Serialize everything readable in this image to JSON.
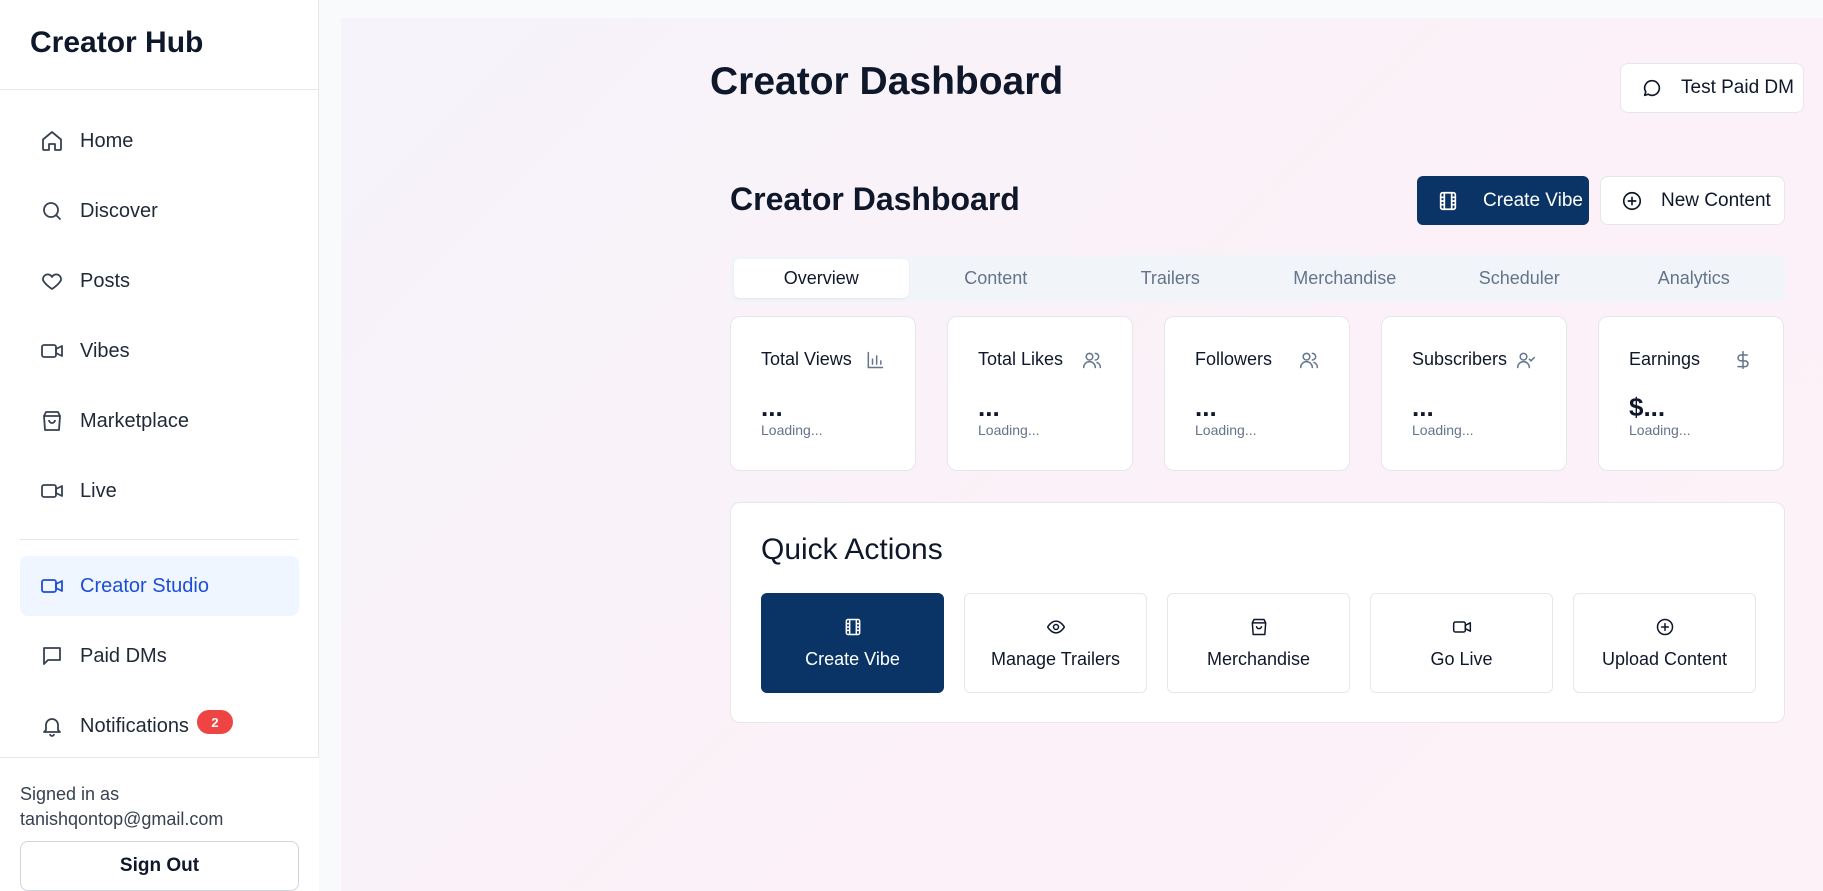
{
  "sidebar": {
    "brand": "Creator Hub",
    "items": [
      {
        "label": "Home",
        "icon": "home-icon"
      },
      {
        "label": "Discover",
        "icon": "search-icon"
      },
      {
        "label": "Posts",
        "icon": "heart-icon"
      },
      {
        "label": "Vibes",
        "icon": "video-icon"
      },
      {
        "label": "Marketplace",
        "icon": "shopping-bag-icon"
      },
      {
        "label": "Live",
        "icon": "video-icon"
      }
    ],
    "creator_items": [
      {
        "label": "Creator Studio",
        "icon": "video-icon",
        "active": true
      },
      {
        "label": "Paid DMs",
        "icon": "message-square-icon"
      },
      {
        "label": "Notifications",
        "icon": "bell-icon",
        "badge": "2"
      }
    ],
    "signed_in_label": "Signed in as",
    "email": "tanishqontop@gmail.com",
    "sign_out": "Sign Out"
  },
  "header": {
    "title": "Creator Dashboard",
    "test_dm_button": "Test Paid DM"
  },
  "dashboard": {
    "title": "Creator Dashboard",
    "create_vibe": "Create Vibe",
    "new_content": "New Content",
    "tabs": [
      "Overview",
      "Content",
      "Trailers",
      "Merchandise",
      "Scheduler",
      "Analytics"
    ],
    "active_tab": "Overview",
    "stats": [
      {
        "label": "Total Views",
        "value": "...",
        "sub": "Loading...",
        "icon": "bar-chart-icon"
      },
      {
        "label": "Total Likes",
        "value": "...",
        "sub": "Loading...",
        "icon": "users-icon"
      },
      {
        "label": "Followers",
        "value": "...",
        "sub": "Loading...",
        "icon": "users-icon"
      },
      {
        "label": "Subscribers",
        "value": "...",
        "sub": "Loading...",
        "icon": "user-check-icon"
      },
      {
        "label": "Earnings",
        "value": "$...",
        "sub": "Loading...",
        "icon": "dollar-icon"
      }
    ]
  },
  "quick_actions": {
    "title": "Quick Actions",
    "buttons": [
      {
        "label": "Create Vibe",
        "icon": "film-icon"
      },
      {
        "label": "Manage Trailers",
        "icon": "eye-icon"
      },
      {
        "label": "Merchandise",
        "icon": "shopping-bag-icon"
      },
      {
        "label": "Go Live",
        "icon": "video-icon"
      },
      {
        "label": "Upload Content",
        "icon": "plus-circle-icon"
      }
    ]
  },
  "colors": {
    "primary": "#0b3466",
    "active_nav_bg": "#eff6ff",
    "active_nav_text": "#1d4ed8",
    "badge": "#ef4444"
  }
}
